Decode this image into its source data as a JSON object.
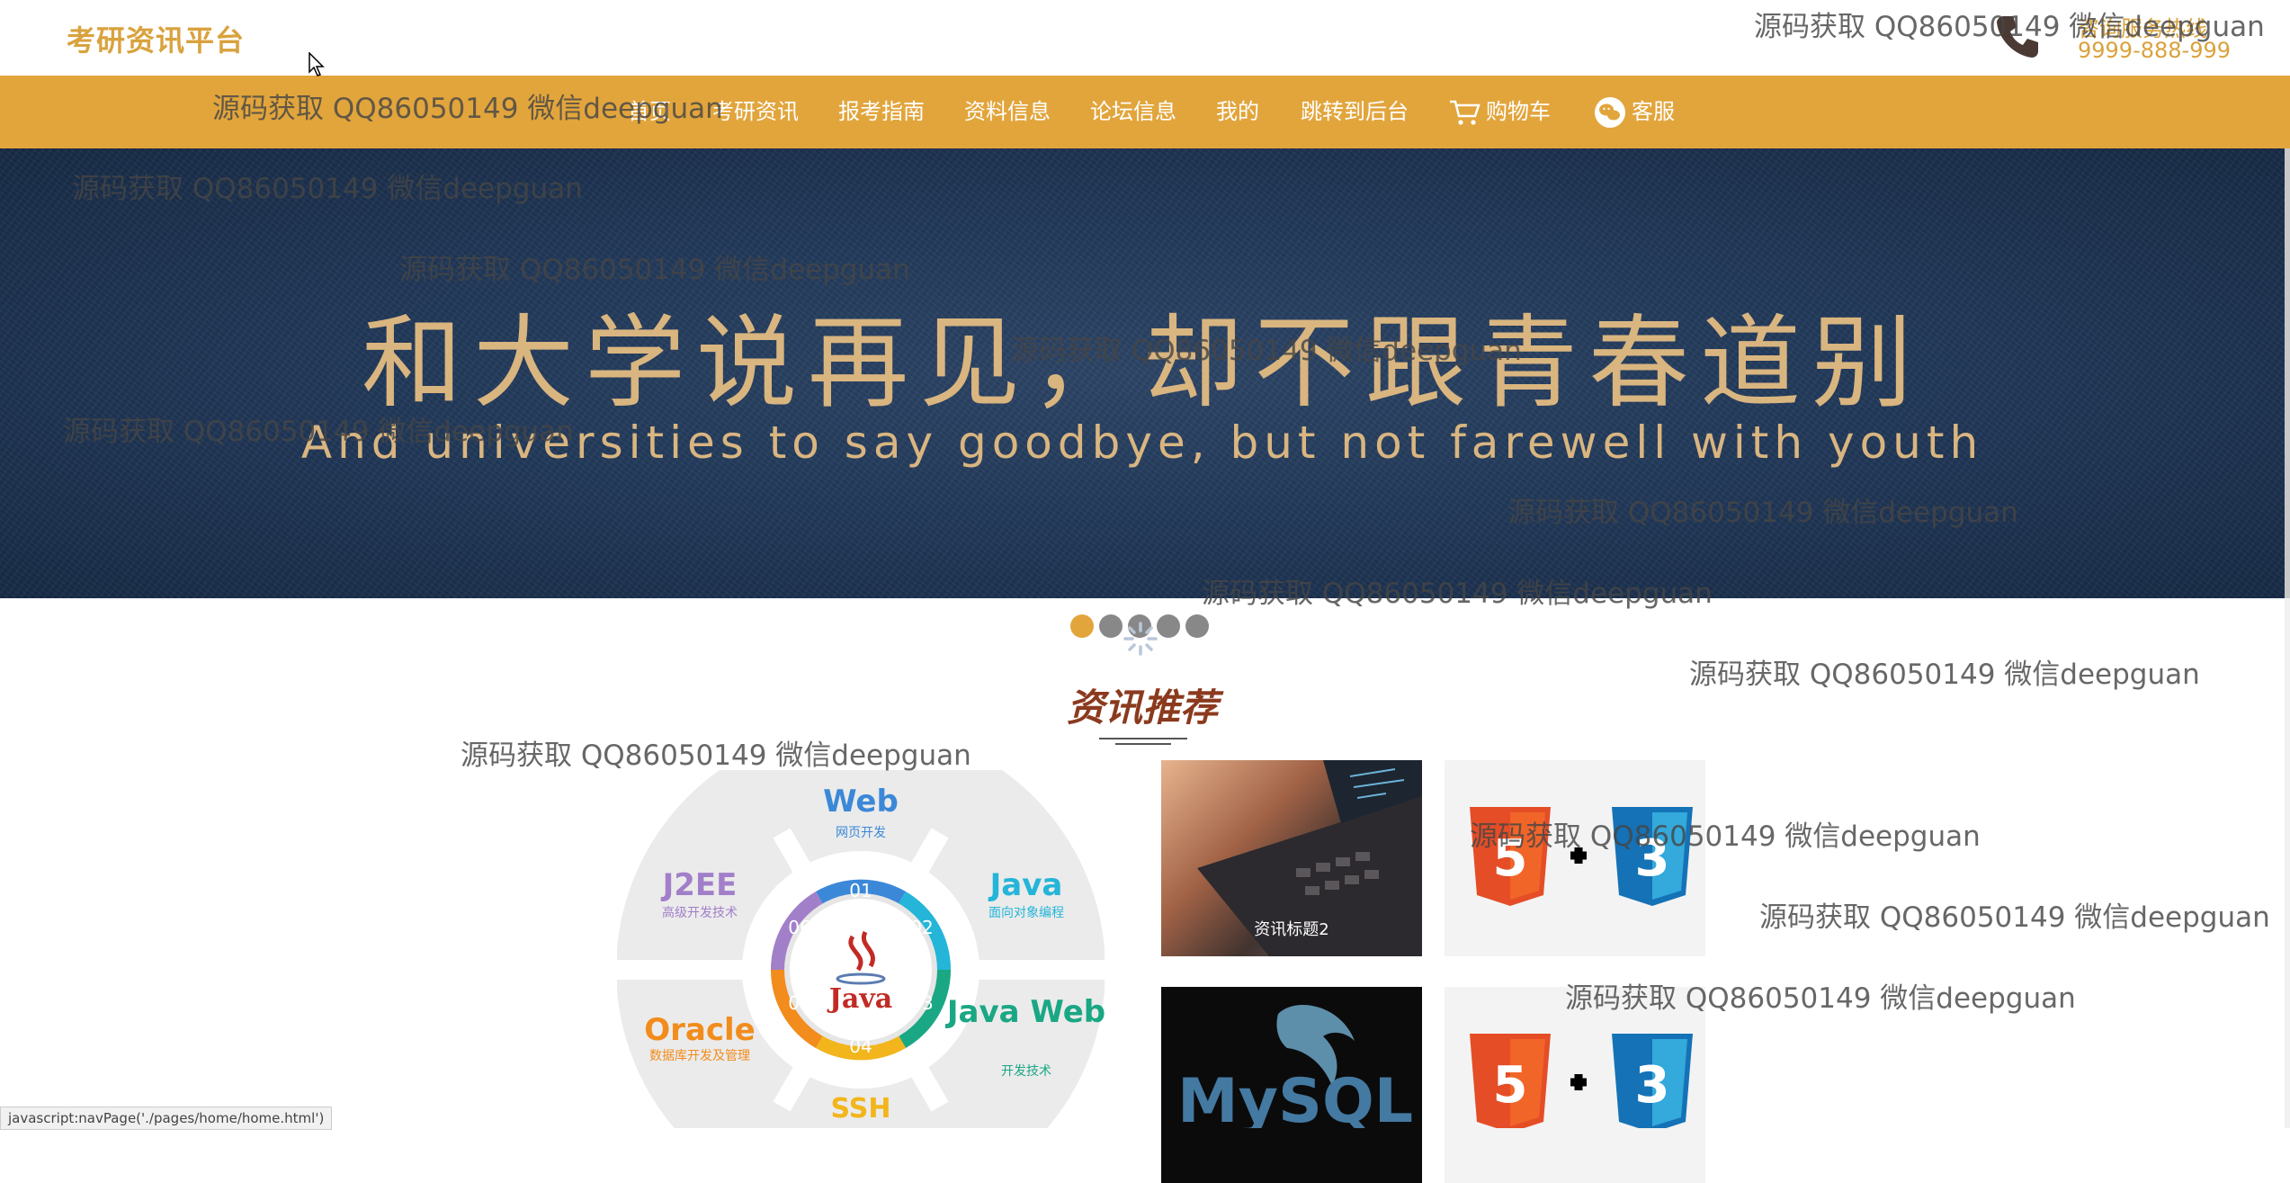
{
  "header": {
    "logo": "考研资讯平台",
    "hotline_label": "咨询服务热线",
    "hotline_number": "9999-888-999"
  },
  "nav": {
    "items": [
      {
        "label": "首页"
      },
      {
        "label": "考研资讯"
      },
      {
        "label": "报考指南"
      },
      {
        "label": "资料信息"
      },
      {
        "label": "论坛信息"
      },
      {
        "label": "我的"
      },
      {
        "label": "跳转到后台"
      },
      {
        "label": "购物车",
        "icon": "cart-icon"
      },
      {
        "label": "客服",
        "icon": "wechat-icon"
      }
    ]
  },
  "banner": {
    "title": "和大学说再见，却不跟青春道别",
    "subtitle": "And universities to say goodbye, but not farewell with youth",
    "dots": 5,
    "active_dot": 0
  },
  "section": {
    "title": "资讯推荐"
  },
  "wheel": {
    "center": "Java",
    "segments": [
      {
        "num": "01",
        "title": "Web",
        "sub": "网页开发"
      },
      {
        "num": "02",
        "title": "Java",
        "sub": "面向对象编程"
      },
      {
        "num": "03",
        "title": "Java Web",
        "sub": "开发技术"
      },
      {
        "num": "04",
        "title": "SSH",
        "sub": ""
      },
      {
        "num": "05",
        "title": "Oracle",
        "sub": "数据库开发及管理"
      },
      {
        "num": "06",
        "title": "J2EE",
        "sub": "高级开发技术"
      }
    ]
  },
  "cards": [
    {
      "caption": "资讯标题2",
      "image": "laptop"
    },
    {
      "caption": "",
      "image": "html5-css3"
    },
    {
      "caption": "",
      "image": "mysql",
      "logo_text": "MySQL"
    },
    {
      "caption": "",
      "image": "html5-css3"
    }
  ],
  "watermark": "源码获取 QQ86050149 微信deepguan",
  "status_bar": "javascript:navPage('./pages/home/home.html')",
  "colors": {
    "accent": "#e2a53c",
    "banner_bg": "#22395a",
    "section_title": "#8b3a1e"
  }
}
